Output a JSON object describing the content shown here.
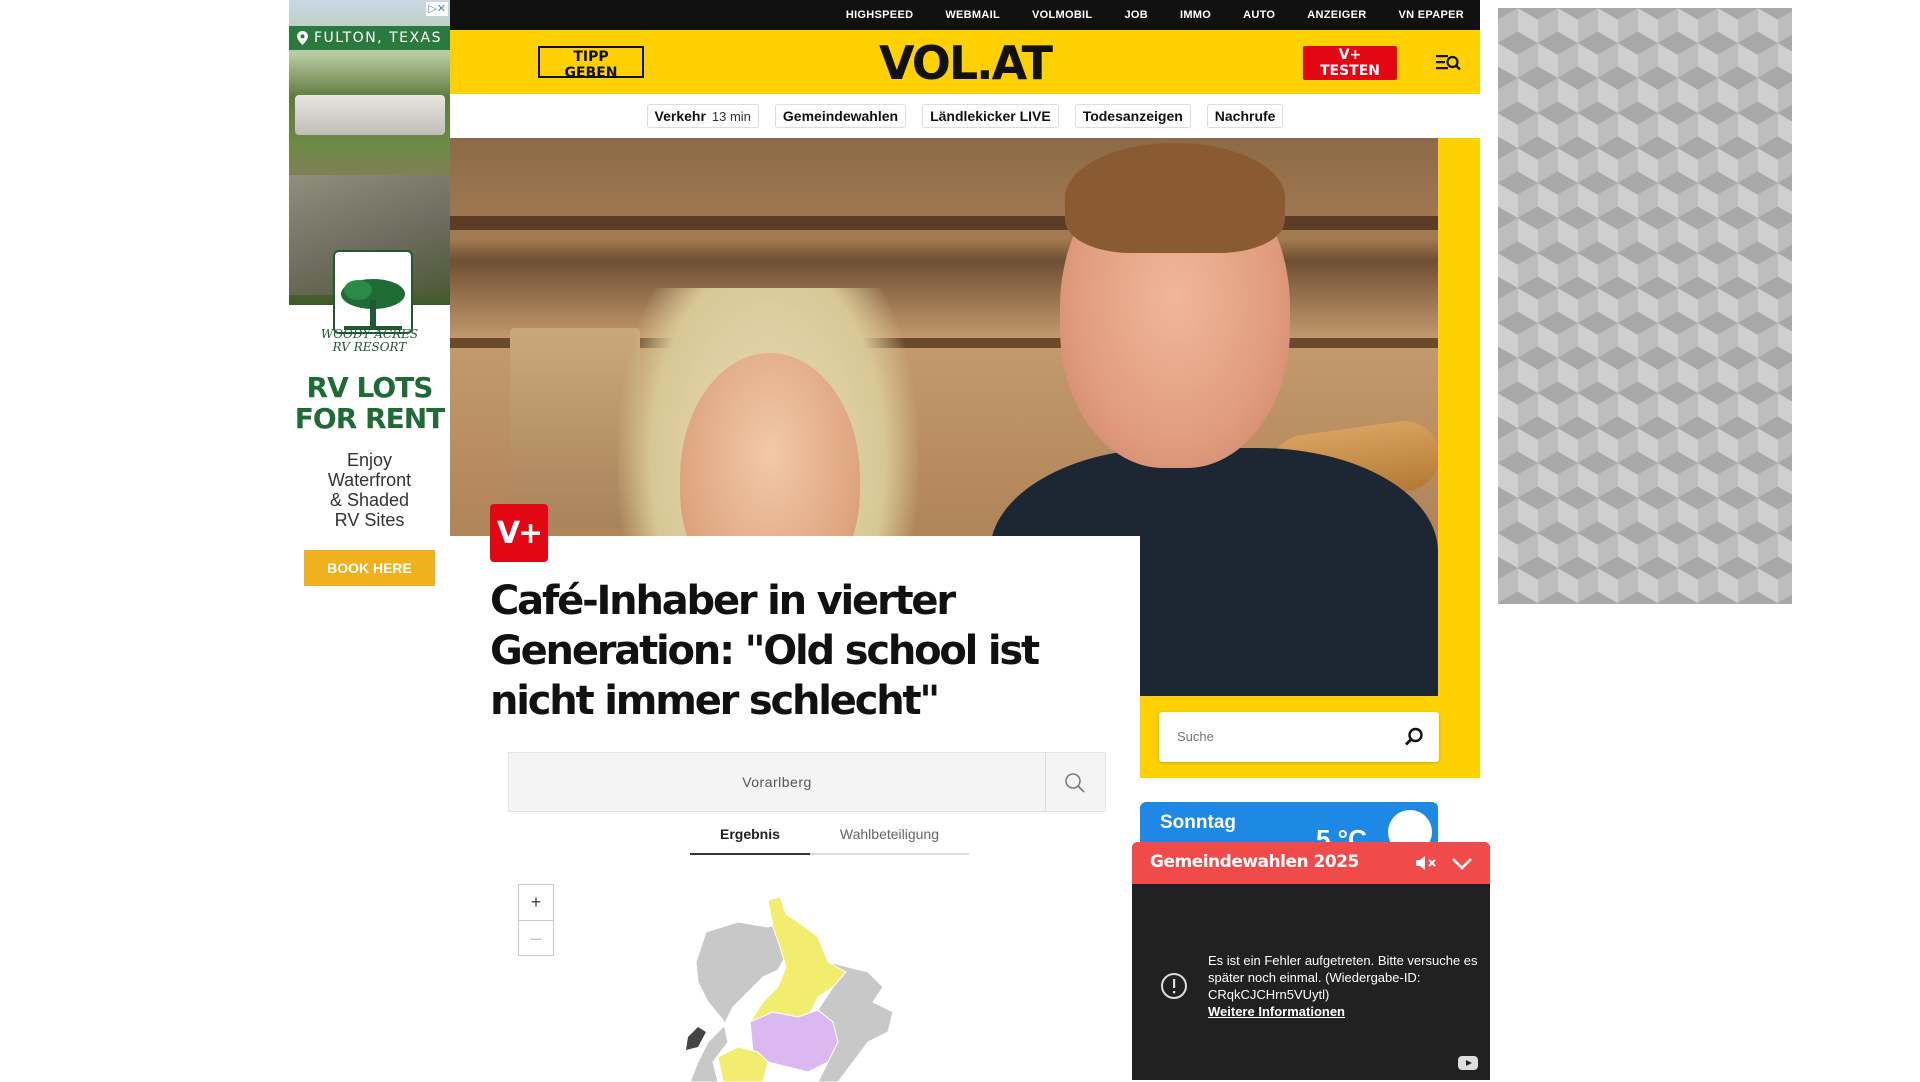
{
  "left_ad": {
    "adchoices": "▷✕",
    "location": "FULTON, TEXAS",
    "logo_line1": "WOODY ACRES",
    "logo_line2": "RV RESORT",
    "headline_line1": "RV LOTS",
    "headline_line2": "FOR RENT",
    "body_lines": [
      "Enjoy",
      "Waterfront",
      "& Shaded",
      "RV Sites"
    ],
    "cta": "BOOK HERE"
  },
  "topbar": {
    "links": [
      "HIGHSPEED",
      "WEBMAIL",
      "VOLMOBIL",
      "JOB",
      "IMMO",
      "AUTO",
      "ANZEIGER",
      "VN EPAPER"
    ]
  },
  "header": {
    "tipp_label": "TIPP GEBEN",
    "brand": "VOL.AT",
    "vplus_label": "V+ TESTEN",
    "brand_yellow": "#ffd100",
    "accent_red": "#e30613"
  },
  "subnav": {
    "traffic_label": "Verkehr",
    "traffic_time": "13 min",
    "items": [
      "Gemeindewahlen",
      "Ländlekicker LIVE",
      "Todesanzeigen",
      "Nachrufe"
    ]
  },
  "article": {
    "badge": "V+",
    "headline": "Café-Inhaber in vierter Generation: \"Old school ist nicht immer schlecht\""
  },
  "sidebar": {
    "search_placeholder": "Suche",
    "weather_day": "Sonntag",
    "weather_temp": "5 °C"
  },
  "election_widget": {
    "region": "Vorarlberg",
    "tabs": [
      "Ergebnis",
      "Wahlbeteiligung"
    ],
    "zoom_in": "+",
    "zoom_out": "–",
    "map_colors": {
      "gray": "#c8c8c8",
      "yellow": "#f2ec6f",
      "purple": "#dcb8f0",
      "dark": "#444444"
    }
  },
  "video_popup": {
    "title": "Gemeindewahlen 2025",
    "error_text": "Es ist ein Fehler aufgetreten. Bitte versuche es später noch einmal. (Wiedergabe-ID: CRqkCJCHrn5VUytl)",
    "more_info": "Weitere Informationen"
  },
  "icons": {
    "location": "location-pin-icon",
    "menu_search": "menu-search-icon",
    "search": "search-icon",
    "mute": "mute-icon",
    "collapse": "chevron-down-icon",
    "error": "error-circle-icon",
    "youtube": "youtube-icon"
  }
}
